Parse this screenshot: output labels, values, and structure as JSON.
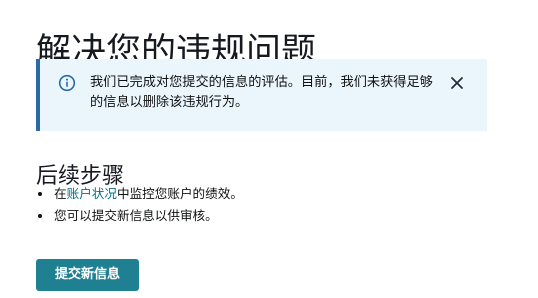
{
  "page": {
    "title": "解决您的违规问题"
  },
  "alert": {
    "type": "info",
    "icon": "info-circle-icon",
    "close_icon": "close-icon",
    "message": "我们已完成对您提交的信息的评估。目前，我们未获得足够的信息以删除该违规行为。",
    "accent_color": "#2a6aa6",
    "background_color": "#eaf6fc"
  },
  "next_steps": {
    "title": "后续步骤",
    "items": [
      {
        "prefix": "在",
        "link": "账户状况",
        "suffix": "中监控您账户的绩效。"
      },
      {
        "text": "您可以提交新信息以供审核。"
      }
    ]
  },
  "actions": {
    "submit_label": "提交新信息",
    "button_color": "#1f8092"
  },
  "colors": {
    "link": "#007185",
    "text": "#0f1111"
  }
}
